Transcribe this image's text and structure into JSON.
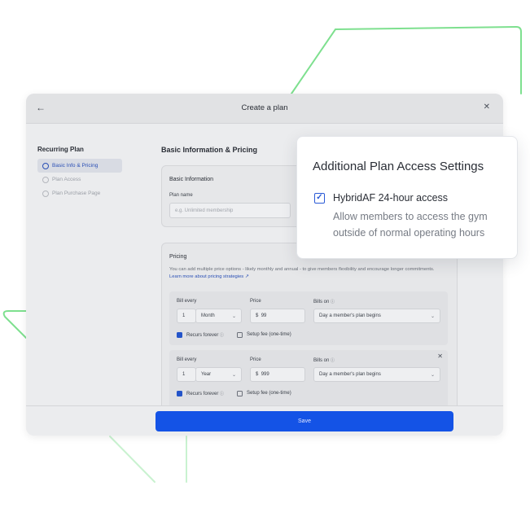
{
  "modal": {
    "title": "Create a plan",
    "back_icon": "arrow-left-icon",
    "close_icon": "close-icon"
  },
  "sidebar": {
    "heading": "Recurring Plan",
    "items": [
      {
        "label": "Basic Info & Pricing",
        "active": true
      },
      {
        "label": "Plan Access",
        "active": false
      },
      {
        "label": "Plan Purchase Page",
        "active": false
      }
    ]
  },
  "main": {
    "section_title": "Basic Information & Pricing",
    "basic_info": {
      "title": "Basic Information",
      "plan_name_label": "Plan name",
      "plan_name_placeholder": "e.g. Unlimited membership"
    },
    "pricing": {
      "title": "Pricing",
      "description": "You can add multiple price options - likely monthly and annual - to give members flexibility and encourage longer commitments.",
      "link": "Learn more about pricing strategies",
      "options": [
        {
          "bill_every_label": "Bill every",
          "interval_count": "1",
          "interval_unit": "Month",
          "price_label": "Price",
          "currency": "$",
          "price": "99",
          "bills_on_label": "Bills on",
          "bills_on_value": "Day a member's plan begins",
          "recurs_label": "Recurs forever",
          "setup_fee_label": "Setup fee (one-time)"
        },
        {
          "bill_every_label": "Bill every",
          "interval_count": "1",
          "interval_unit": "Year",
          "price_label": "Price",
          "currency": "$",
          "price": "999",
          "bills_on_label": "Bills on",
          "bills_on_value": "Day a member's plan begins",
          "recurs_label": "Recurs forever",
          "setup_fee_label": "Setup fee (one-time)"
        }
      ]
    }
  },
  "footer": {
    "save_label": "Save"
  },
  "popup": {
    "title": "Additional Plan Access Settings",
    "option_label": "HybridAF 24-hour access",
    "option_checked": true,
    "option_description": "Allow members to access the gym outside of normal operating hours"
  },
  "colors": {
    "accent": "#1453e6",
    "decor_green": "#7ee08f"
  }
}
